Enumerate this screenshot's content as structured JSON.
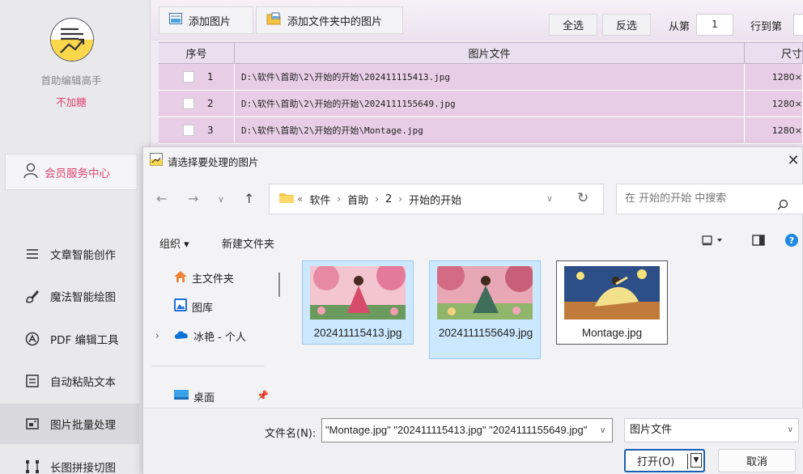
{
  "sidebar": {
    "app_name": "首助编辑高手",
    "app_subtitle": "不加糖",
    "member_center": "会员服务中心",
    "items": [
      {
        "label": "文章智能创作",
        "icon": "list-icon"
      },
      {
        "label": "魔法智能绘图",
        "icon": "brush-icon"
      },
      {
        "label": "PDF 编辑工具",
        "icon": "pdf-icon"
      },
      {
        "label": "自动粘贴文本",
        "icon": "clipboard-icon"
      },
      {
        "label": "图片批量处理",
        "icon": "image-batch-icon",
        "active": true
      },
      {
        "label": "长图拼接切图",
        "icon": "crop-icon"
      }
    ]
  },
  "toolbar": {
    "add_image": "添加图片",
    "add_folder_images": "添加文件夹中的图片",
    "select_all": "全选",
    "invert_select": "反选",
    "from_label": "从第",
    "from_value": "1",
    "to_label": "行到第"
  },
  "table": {
    "headers": [
      "序号",
      "图片文件",
      "尺寸"
    ],
    "rows": [
      {
        "index": "1",
        "file": "D:\\软件\\首助\\2\\开始的开始\\202411115413.jpg",
        "size": "1280×"
      },
      {
        "index": "2",
        "file": "D:\\软件\\首助\\2\\开始的开始\\2024111155649.jpg",
        "size": "1280×"
      },
      {
        "index": "3",
        "file": "D:\\软件\\首助\\2\\开始的开始\\Montage.jpg",
        "size": "1280×"
      }
    ]
  },
  "dialog": {
    "title": "请选择要处理的图片",
    "address": {
      "prefix": "«",
      "segments": [
        "软件",
        "首助",
        "2",
        "开始的开始"
      ]
    },
    "search_placeholder": "在 开始的开始 中搜索",
    "organize": "组织 ▾",
    "new_folder": "新建文件夹",
    "nav": [
      {
        "label": "主文件夹",
        "icon": "home-icon"
      },
      {
        "label": "图库",
        "icon": "gallery-icon"
      },
      {
        "label": "冰艳 - 个人",
        "icon": "cloud-icon"
      },
      {
        "label": "桌面",
        "icon": "desktop-icon"
      }
    ],
    "files": [
      {
        "name": "202411115413.jpg",
        "selected": true
      },
      {
        "name": "2024111155649.jpg",
        "selected": true
      },
      {
        "name": "Montage.jpg",
        "selected": false
      }
    ],
    "filename_label": "文件名(N):",
    "filename_value": "\"Montage.jpg\" \"202411115413.jpg\" \"2024111155649.jpg\"",
    "filetype": "图片文件",
    "open": "打开(O)",
    "cancel": "取消"
  },
  "colors": {
    "accent_pink": "#e0416f",
    "row_bg": "#e8cde6",
    "selection_blue": "#cce8ff"
  }
}
